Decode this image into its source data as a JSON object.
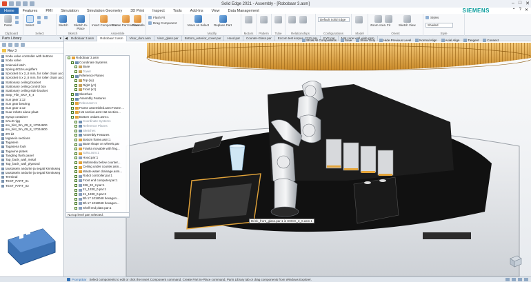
{
  "window": {
    "title": "Solid Edge 2021 - Assembly - [Robobaar 3.asm]",
    "brand": "SIEMENS"
  },
  "menu": {
    "home": "Home",
    "tabs": [
      "Features",
      "PMI",
      "Simulation",
      "Simulation Geometry",
      "3D Print",
      "Inspect",
      "Tools",
      "Add-Ins",
      "View",
      "Data Management"
    ]
  },
  "ribbon": {
    "clipboard": {
      "label": "Clipboard",
      "paste": "Paste"
    },
    "select": {
      "label": "Select",
      "select_btn": "Select"
    },
    "sketch": {
      "label": "Sketch",
      "sketch_btn": "Sketch",
      "sketch_in_place": "Sketch In-Place",
      "sketch_area": "Sketch"
    },
    "assemble": {
      "label": "Assemble",
      "insert_component": "Insert Component",
      "create_part_in_place": "Create Part In-Place",
      "assemble_btn": "Assemble",
      "flash_fit": "Flash Fit",
      "drag_component": "Drag Component"
    },
    "modify": {
      "label": "Modify",
      "move_on_select": "Move on Select",
      "replace_part": "Replace Part"
    },
    "motors": "Motors",
    "pattern": "Pattern",
    "tube": "Tube",
    "relationships": "Relationships",
    "configurations": {
      "label": "Configurations",
      "current": "Default Solid Edge"
    },
    "model": "Model",
    "orient": {
      "label": "Orient",
      "zoom_area": "Zoom Area",
      "fit": "Fit",
      "sketch_view": "Sketch View"
    },
    "style": {
      "label": "Style",
      "styles": "Styles",
      "shaded": "Shaded"
    }
  },
  "parts_library": {
    "title": "Parts Library",
    "folder": "Rev 3",
    "items": [
      "Soda valve controller with buttons",
      "Soda valve",
      "Solenoid latch",
      "Spring 6015-Lesjoffers",
      "Sprocket 6 x 2_8 mm, for roller chain accs",
      "Sprocket 6 x 2_8 mm, for roller chain accs",
      "Stationary ceiling bracket",
      "Stationary ceiling control box",
      "Stationary ceiling side bracket",
      "Step_File_SKV_6_4",
      "Sun gear 1:12",
      "Sun gear bearing",
      "Sun gear 1:12",
      "Suur robots alune plaat",
      "Syrup container",
      "SALD rigg",
      "srv_hist_3m_09_8_17024800",
      "srv_hist_3m_09_8_17024800",
      "ZO kit",
      "tagasein sections",
      "Tagasein",
      "Tagasena louk",
      "Tagavine plates",
      "Tangling flush panel",
      "Tap_back_wall_metal",
      "Tap_back_wall_plywood",
      "taustasein andurite ja segati kinnituseg",
      "taustasein andurite ja segati kinnituseg",
      "Terminal",
      "TEST_PART_01",
      "TEST_PART_02"
    ]
  },
  "doc_tabs": [
    "Robobaar 3.asm",
    "Robobaar 3.asm",
    "Visor_dom.asm",
    "Visor_glass.par",
    "Bottom_exterior_cover.par",
    "Hood.par",
    "Counter-Glass.par",
    "Eccom test korpus_2121.par",
    "EYE.par",
    "Mat cone wall wide.psm"
  ],
  "command_bar": [
    "Show All Components",
    "Save",
    "Show Only",
    "Hide Previous Level",
    "Normal Align",
    "Axial Align",
    "Tangent",
    "Connect"
  ],
  "pathfinder": {
    "nodes": [
      {
        "label": "Robobaar 3.asm",
        "icon": "asm",
        "indent": 0,
        "dim": false
      },
      {
        "label": "Coordinate Systems",
        "icon": "grp",
        "indent": 1,
        "dim": false
      },
      {
        "label": "Base",
        "icon": "plane",
        "indent": 2,
        "dim": false
      },
      {
        "label": "Tower",
        "icon": "plane",
        "indent": 2,
        "dim": true
      },
      {
        "label": "Reference Planes",
        "icon": "grp",
        "indent": 1,
        "dim": false
      },
      {
        "label": "Top (xy)",
        "icon": "plane",
        "indent": 2,
        "dim": false
      },
      {
        "label": "Right (yz)",
        "icon": "plane",
        "indent": 2,
        "dim": false
      },
      {
        "label": "Front (xz)",
        "icon": "plane",
        "indent": 2,
        "dim": false
      },
      {
        "label": "Sketches",
        "icon": "grp",
        "indent": 1,
        "dim": false
      },
      {
        "label": "Assembly Features",
        "icon": "grp",
        "indent": 1,
        "dim": false
      },
      {
        "label": "Robot.asm:1",
        "icon": "asm",
        "indent": 1,
        "dim": true
      },
      {
        "label": "Frame assembled.asm:Frame ...",
        "icon": "asm",
        "indent": 1,
        "dim": false
      },
      {
        "label": "Hat section.asm:Hat section...",
        "icon": "asm",
        "indent": 1,
        "dim": false
      },
      {
        "label": "Bottom ondam.asm:1",
        "icon": "asm",
        "indent": 1,
        "dim": false
      },
      {
        "label": "Coordinate Systems",
        "icon": "grp",
        "indent": 2,
        "dim": true
      },
      {
        "label": "Reference Planes",
        "icon": "grp",
        "indent": 2,
        "dim": true
      },
      {
        "label": "Sketches",
        "icon": "grp",
        "indent": 2,
        "dim": true
      },
      {
        "label": "Assembly Features",
        "icon": "grp",
        "indent": 2,
        "dim": false
      },
      {
        "label": "Bottom frame.asm:1",
        "icon": "asm",
        "indent": 2,
        "dim": false
      },
      {
        "label": "Base shape on wheels.par",
        "icon": "par",
        "indent": 2,
        "dim": false
      },
      {
        "label": "Franka movable with fing...",
        "icon": "asm",
        "indent": 2,
        "dim": false
      },
      {
        "label": "Soko.asm:1",
        "icon": "asm",
        "indent": 2,
        "dim": true
      },
      {
        "label": "Hood.par:1",
        "icon": "par",
        "indent": 2,
        "dim": false
      },
      {
        "label": "Multimedia below counter...",
        "icon": "asm",
        "indent": 2,
        "dim": false
      },
      {
        "label": "Ceiling under counter.asm...",
        "icon": "asm",
        "indent": 2,
        "dim": false
      },
      {
        "label": "Waste water drainage.asm...",
        "icon": "asm",
        "indent": 2,
        "dim": false
      },
      {
        "label": "Robot controller.par:1",
        "icon": "par",
        "indent": 2,
        "dim": false
      },
      {
        "label": "Front end computer.par:1",
        "icon": "par",
        "indent": 2,
        "dim": false
      },
      {
        "label": "338_32_2.par:1",
        "icon": "par",
        "indent": 2,
        "dim": false
      },
      {
        "label": "21_1330_0.par:1",
        "icon": "par",
        "indent": 2,
        "dim": false
      },
      {
        "label": "21_1330_0.par:2",
        "icon": "par",
        "indent": 2,
        "dim": false
      },
      {
        "label": "Bh 17 1018048 hexagon...",
        "icon": "par",
        "indent": 2,
        "dim": false
      },
      {
        "label": "Bh 17 1018048 hexagon...",
        "icon": "par",
        "indent": 2,
        "dim": false
      },
      {
        "label": "Shelf end plate.par:1",
        "icon": "par",
        "indent": 2,
        "dim": false
      }
    ],
    "status": "No top level part selected."
  },
  "tooltip": "Drink_front_glass.par:1 in DOCK_3_0.asm:1",
  "status_bar": {
    "prompt_bar": "PromptBar",
    "message": "Select components to edit or click the Insert Component command, Create Part In-Place command, Parts Library tab or drag components from Windows Explorer."
  },
  "colors": {
    "accent": "#2f6fb5",
    "brand": "#009999",
    "hood": "#e2a43a",
    "preview": "#3a6fb0"
  }
}
